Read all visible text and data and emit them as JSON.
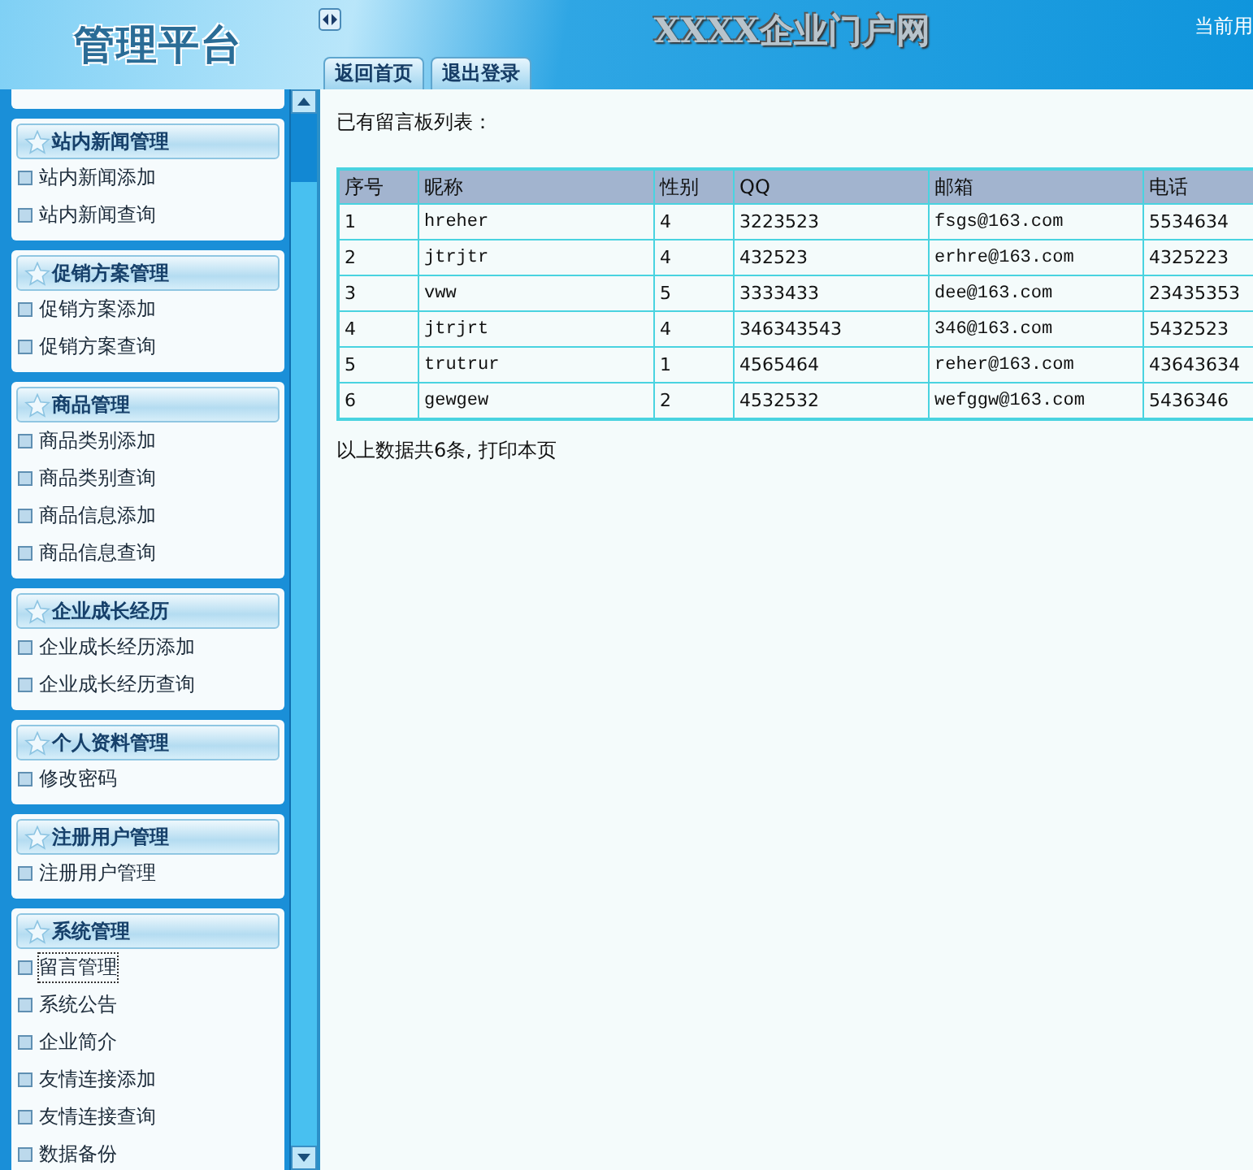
{
  "header": {
    "logo": "管理平台",
    "title": "XXXX企业门户网",
    "user_text": "当前用",
    "tabs": [
      {
        "label": "返回首页"
      },
      {
        "label": "退出登录"
      }
    ]
  },
  "sidebar": {
    "groups": [
      {
        "title": "站内新闻管理",
        "items": [
          {
            "label": "站内新闻添加",
            "selected": false
          },
          {
            "label": "站内新闻查询",
            "selected": false
          }
        ]
      },
      {
        "title": "促销方案管理",
        "items": [
          {
            "label": "促销方案添加",
            "selected": false
          },
          {
            "label": "促销方案查询",
            "selected": false
          }
        ]
      },
      {
        "title": "商品管理",
        "items": [
          {
            "label": "商品类别添加",
            "selected": false
          },
          {
            "label": "商品类别查询",
            "selected": false
          },
          {
            "label": "商品信息添加",
            "selected": false
          },
          {
            "label": "商品信息查询",
            "selected": false
          }
        ]
      },
      {
        "title": "企业成长经历",
        "items": [
          {
            "label": "企业成长经历添加",
            "selected": false
          },
          {
            "label": "企业成长经历查询",
            "selected": false
          }
        ]
      },
      {
        "title": "个人资料管理",
        "items": [
          {
            "label": "修改密码",
            "selected": false
          }
        ]
      },
      {
        "title": "注册用户管理",
        "items": [
          {
            "label": "注册用户管理",
            "selected": false
          }
        ]
      },
      {
        "title": "系统管理",
        "items": [
          {
            "label": "留言管理",
            "selected": true
          },
          {
            "label": "系统公告",
            "selected": false
          },
          {
            "label": "企业简介",
            "selected": false
          },
          {
            "label": "友情连接添加",
            "selected": false
          },
          {
            "label": "友情连接查询",
            "selected": false
          },
          {
            "label": "数据备份",
            "selected": false
          }
        ]
      }
    ]
  },
  "main": {
    "heading": "已有留言板列表：",
    "table": {
      "columns": [
        "序号",
        "昵称",
        "性别",
        "QQ",
        "邮箱",
        "电话"
      ],
      "rows": [
        [
          "1",
          "hreher",
          "4",
          "3223523",
          "fsgs@163.com",
          "5534634"
        ],
        [
          "2",
          "jtrjtr",
          "4",
          "432523",
          "erhre@163.com",
          "4325223"
        ],
        [
          "3",
          "vww",
          "5",
          "3333433",
          "dee@163.com",
          "23435353"
        ],
        [
          "4",
          "jtrjrt",
          "4",
          "346343543",
          "346@163.com",
          "5432523"
        ],
        [
          "5",
          "trutrur",
          "1",
          "4565464",
          "reher@163.com",
          "43643634"
        ],
        [
          "6",
          "gewgew",
          "2",
          "4532532",
          "wefggw@163.com",
          "5436346"
        ]
      ]
    },
    "footer": "以上数据共6条, 打印本页"
  }
}
